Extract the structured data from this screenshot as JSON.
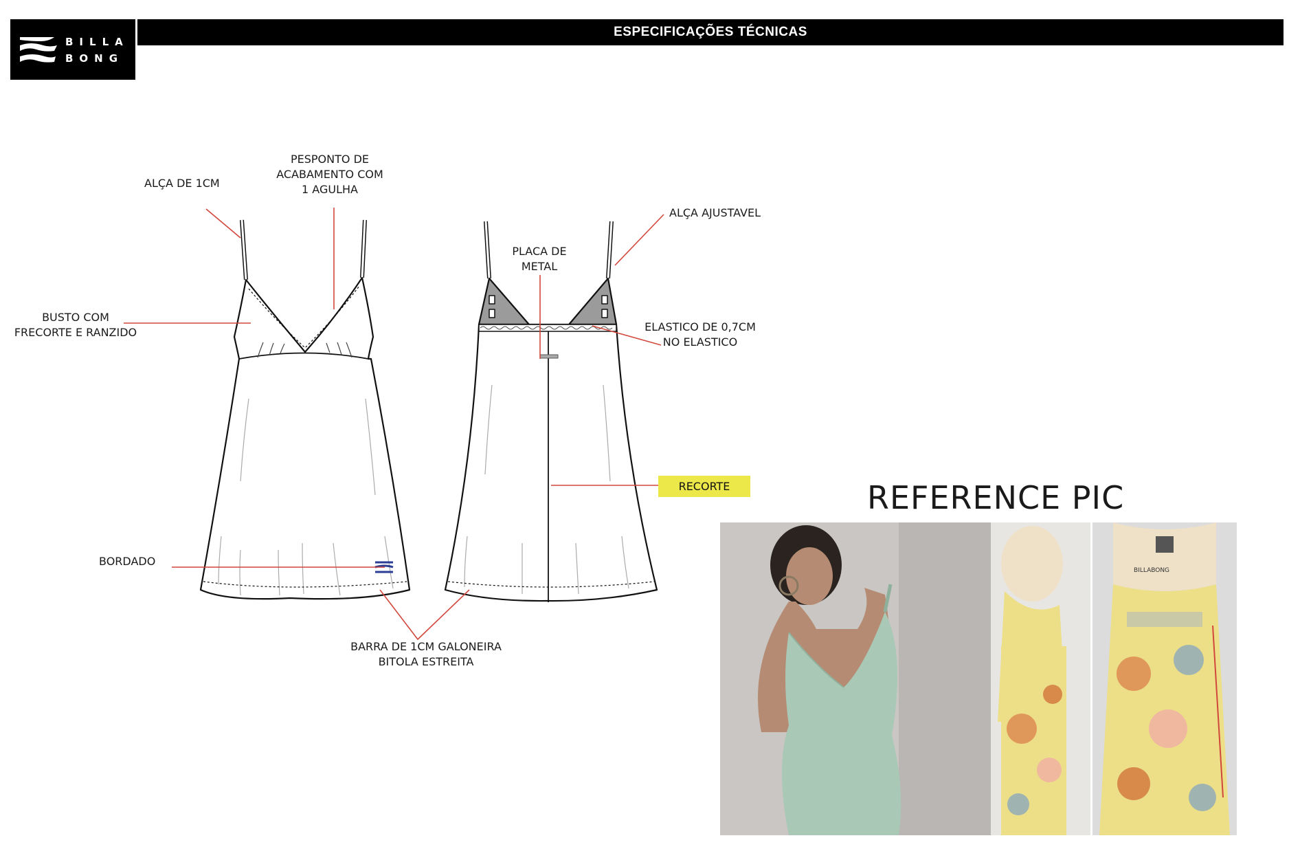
{
  "header": {
    "brand_line1": "BILLA",
    "brand_line2": "BONG",
    "title": "ESPECIFICAÇÕES TÉCNICAS"
  },
  "labels": {
    "alca_1cm": "ALÇA DE 1CM",
    "pesponto_1": "PESPONTO DE",
    "pesponto_2": "ACABAMENTO COM",
    "pesponto_3": "1 AGULHA",
    "busto_1": "BUSTO COM",
    "busto_2": "FRECORTE E RANZIDO",
    "bordado": "BORDADO",
    "barra_1": "BARRA DE 1CM GALONEIRA",
    "barra_2": "BITOLA ESTREITA",
    "placa_1": "PLACA DE",
    "placa_2": "METAL",
    "alca_ajustavel": "ALÇA AJUSTAVEL",
    "elastico_1": "ELASTICO DE 0,7CM",
    "elastico_2": "NO ELASTICO",
    "recorte": "RECORTE"
  },
  "reference": {
    "title": "REFERENCE PIC",
    "mannequin_brand": "BILLABONG"
  },
  "colors": {
    "callout_line": "#d2473c",
    "recorte_highlight": "#ece84a",
    "strap_gray": "#9b9b9b",
    "embroidery_blue": "#2b3d94",
    "green_dress": "#a9c8b5",
    "yellow_dress": "#ecdf88"
  }
}
